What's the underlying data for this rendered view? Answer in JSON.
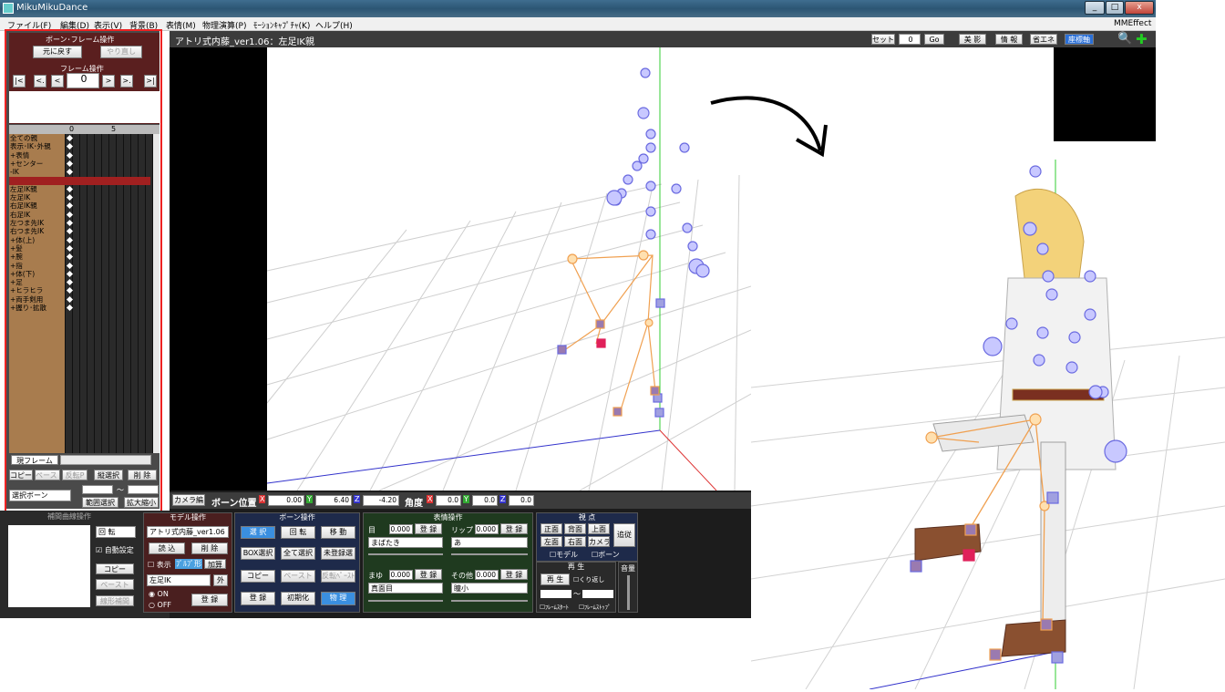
{
  "window": {
    "title": "MikuMikuDance",
    "buttons": [
      "_",
      "□",
      "x"
    ]
  },
  "menu": {
    "items": [
      "ファイル(F)",
      "編集(D)",
      "表示(V)",
      "背景(B)",
      "表情(M)",
      "物理演算(P)",
      "ﾓｰｼｮﾝｷｬﾌﾟﾁｬ(K)",
      "ヘルプ(H)"
    ],
    "right": "MMEffect"
  },
  "left_panel": {
    "title": "ボーン･フレーム操作",
    "undo": "元に戻す",
    "redo": "やり直し",
    "frame_ops": "フレーム操作",
    "nav": [
      "|<",
      "<.",
      "<",
      ">",
      ">.",
      ">|"
    ],
    "frame_value": "0",
    "ruler": [
      "0",
      "5"
    ],
    "bones": [
      "全ての親",
      "表示･IK･外親",
      "+表情",
      "+センター",
      "-IK",
      "左足IK親",
      "左足IK",
      "右足IK親",
      "右足IK",
      "左つま先IK",
      "右つま先IK",
      "+体(上)",
      "+髪",
      "+腕",
      "+指",
      "+体(下)",
      "+足",
      "+ヒラヒラ",
      "+両手剣用",
      "+握り･拡散"
    ],
    "new_frame": "現フレーム",
    "actions": [
      "コピー",
      "ペースト",
      "反転P",
      "縦選択",
      "削 除"
    ],
    "select_bone": "選択ボーン",
    "range_select": "範囲選択",
    "zoom": "拡大縮小",
    "tilde": "～",
    "interp_title": "補間曲線操作",
    "rotate": "回 転",
    "auto_set": "自動設定",
    "copy": "コピー",
    "paste": "ペースト",
    "linear": "線形補間"
  },
  "view_top": {
    "title": "アトリ式内藤_ver1.06：左足IK親",
    "set": "セット",
    "set_value": "0",
    "go": "Go",
    "buttons": [
      "美 影",
      "情 報",
      "省エネ",
      "座標軸"
    ]
  },
  "bone_pos_bar": {
    "camera": "カメラ編",
    "label": "ボーン位置",
    "x": "0.00",
    "y": "6.40",
    "z": "-4.20",
    "angle": "角度",
    "ax": "0.0",
    "ay": "0.0",
    "az": "0.0"
  },
  "model_ops": {
    "title": "モデル操作",
    "model": "アトリ式内藤_ver1.06",
    "load": "読 込",
    "delete": "削 除",
    "show": "表示",
    "alpha": "ﾌﾞﾙﾌﾞ形",
    "add": "加算",
    "bone": "左足IK",
    "outer": "外",
    "on": "ON",
    "off": "OFF",
    "register": "登 録"
  },
  "bone_ops": {
    "title": "ボーン操作",
    "select": "選 択",
    "rotate": "回 転",
    "move": "移 動",
    "box": "BOX選択",
    "all": "全て選択",
    "unreg": "未登録選",
    "copy": "コピー",
    "paste": "ペースト",
    "flip": "反転ﾍﾟｰｽﾄ",
    "register": "登 録",
    "init": "初期化",
    "physics": "物 理"
  },
  "morph_ops": {
    "title": "表情操作",
    "eye": "目",
    "lip": "リップ",
    "brow": "まゆ",
    "other": "その他",
    "eye_val": "0.000",
    "lip_val": "0.000",
    "brow_val": "0.000",
    "other_val": "0.000",
    "eye_sel": "まばたき",
    "lip_sel": "あ",
    "brow_sel": "真面目",
    "other_sel": "瞳小",
    "register": "登 録"
  },
  "view_ops": {
    "title": "視 点",
    "front": "正面",
    "back": "背面",
    "top": "上面",
    "follow": "追従",
    "left": "左面",
    "right": "右面",
    "camera": "カメラ",
    "model": "モデル",
    "bone": "ボーン"
  },
  "play_ops": {
    "title": "再 生",
    "play": "再 生",
    "loop": "くり返し",
    "start": "ﾌﾚｰﾑｽﾀｰﾄ",
    "stop": "ﾌﾚｰﾑｽﾄｯﾌﾟ",
    "tilde": "～",
    "volume": "音量"
  }
}
